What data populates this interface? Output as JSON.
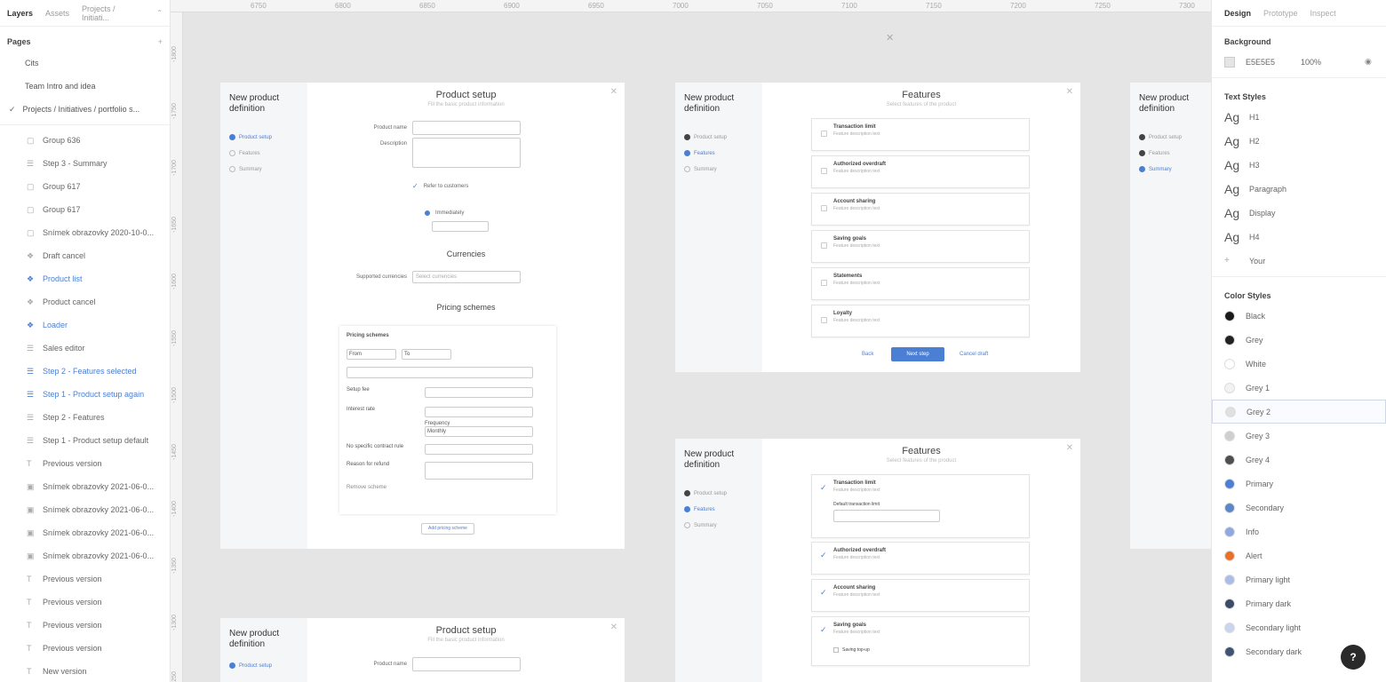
{
  "left_panel": {
    "tabs": [
      "Layers",
      "Assets",
      "Projects / Initiati..."
    ],
    "pages_title": "Pages",
    "add_icon": "plus-icon",
    "pages": [
      "Cits",
      "Team Intro and idea",
      "Projects / Initiatives / portfolio s..."
    ],
    "layers": [
      {
        "label": "Group 636",
        "icon": "frame-icon",
        "blue": false
      },
      {
        "label": "Step 3 - Summary",
        "icon": "grid-icon",
        "blue": false
      },
      {
        "label": "Group 617",
        "icon": "frame-icon",
        "blue": false
      },
      {
        "label": "Group 617",
        "icon": "frame-icon",
        "blue": false
      },
      {
        "label": "Snímek obrazovky 2020-10-0...",
        "icon": "frame-icon",
        "blue": false
      },
      {
        "label": "Draft cancel",
        "icon": "component-icon",
        "blue": false
      },
      {
        "label": "Product list",
        "icon": "component-icon",
        "blue": true
      },
      {
        "label": "Product cancel",
        "icon": "component-icon",
        "blue": false
      },
      {
        "label": "Loader",
        "icon": "component-icon",
        "blue": true
      },
      {
        "label": "Sales editor",
        "icon": "grid-icon",
        "blue": false
      },
      {
        "label": "Step 2 - Features selected",
        "icon": "grid-icon",
        "blue": true
      },
      {
        "label": "Step 1 - Product setup again",
        "icon": "grid-icon",
        "blue": true
      },
      {
        "label": "Step 2 - Features",
        "icon": "grid-icon",
        "blue": false
      },
      {
        "label": "Step 1 - Product setup default",
        "icon": "grid-icon",
        "blue": false
      },
      {
        "label": "Previous version",
        "icon": "text-icon",
        "blue": false
      },
      {
        "label": "Snímek obrazovky 2021-06-0...",
        "icon": "image-icon",
        "blue": false
      },
      {
        "label": "Snímek obrazovky 2021-06-0...",
        "icon": "image-icon",
        "blue": false
      },
      {
        "label": "Snímek obrazovky 2021-06-0...",
        "icon": "image-icon",
        "blue": false
      },
      {
        "label": "Snímek obrazovky 2021-06-0...",
        "icon": "image-icon",
        "blue": false
      },
      {
        "label": "Previous version",
        "icon": "text-icon",
        "blue": false
      },
      {
        "label": "Previous version",
        "icon": "text-icon",
        "blue": false
      },
      {
        "label": "Previous version",
        "icon": "text-icon",
        "blue": false
      },
      {
        "label": "Previous version",
        "icon": "text-icon",
        "blue": false
      },
      {
        "label": "New version",
        "icon": "text-icon",
        "blue": false
      }
    ]
  },
  "ruler": {
    "top": [
      "6750",
      "6800",
      "6850",
      "6900",
      "6950",
      "7000",
      "7050",
      "7100",
      "7150",
      "7200",
      "7250",
      "7300"
    ],
    "left": [
      "-1800",
      "-1750",
      "-1700",
      "-1650",
      "-1600",
      "-1550",
      "-1500",
      "-1450",
      "-1400",
      "-1350",
      "-1300",
      "-1250"
    ]
  },
  "frames": {
    "side_title": "New product definition",
    "steps": [
      "Product setup",
      "Features",
      "Summary"
    ],
    "product_setup": {
      "title": "Product setup",
      "subtitle": "Fill the basic product information",
      "product_name_label": "Product name",
      "description_label": "Description",
      "refer_label": "Refer to customers",
      "immediately_label": "Immediately",
      "currencies_title": "Currencies",
      "supported_currencies_label": "Supported currencies",
      "supported_currencies_value": "Select currencies",
      "pricing_title": "Pricing schemes",
      "pricing_card_title": "Pricing schemes",
      "from": "From",
      "to": "To",
      "setup_fee": "Setup fee",
      "interest_rate": "Interest rate",
      "frequency": "Frequency",
      "monthly": "Monthly",
      "no_specific_label": "No specific contract rule",
      "reason_label": "Reason for refund",
      "remove_label": "Remove scheme",
      "add_button": "Add pricing scheme"
    },
    "features": {
      "title": "Features",
      "subtitle": "Select features of the product",
      "items": [
        "Transaction limit",
        "Authorized overdraft",
        "Account sharing",
        "Saving goals",
        "Statements",
        "Loyalty"
      ],
      "item_desc": "Feature description text",
      "back": "Back",
      "next": "Next step",
      "cancel": "Cancel draft"
    },
    "features_selected": {
      "title": "Features",
      "subtitle": "Select features of the product",
      "items": [
        "Transaction limit",
        "Authorized overdraft",
        "Account sharing",
        "Saving goals"
      ],
      "limit_label": "Default transaction limit",
      "saving_option": "Saving top-up"
    }
  },
  "right_panel": {
    "tabs": [
      "Design",
      "Prototype",
      "Inspect"
    ],
    "background_title": "Background",
    "bg_hex": "E5E5E5",
    "bg_opacity": "100%",
    "eye_icon": "eye-icon",
    "text_styles_title": "Text Styles",
    "text_styles": [
      "H1",
      "H2",
      "H3",
      "Paragraph",
      "Display",
      "H4",
      "Your"
    ],
    "color_styles_title": "Color Styles",
    "color_styles": [
      {
        "name": "Black",
        "color": "#1a1a1a"
      },
      {
        "name": "Grey",
        "color": "#222222"
      },
      {
        "name": "White",
        "color": "#ffffff"
      },
      {
        "name": "Grey 1",
        "color": "#f2f2f2"
      },
      {
        "name": "Grey 2",
        "color": "#e0e0e0"
      },
      {
        "name": "Grey 3",
        "color": "#cfcfcf"
      },
      {
        "name": "Grey 4",
        "color": "#4f4f4f"
      },
      {
        "name": "Primary",
        "color": "#4a7fd4"
      },
      {
        "name": "Secondary",
        "color": "#5b86c8"
      },
      {
        "name": "Info",
        "color": "#8fa9e0"
      },
      {
        "name": "Alert",
        "color": "#e8702a"
      },
      {
        "name": "Primary light",
        "color": "#a9bde6"
      },
      {
        "name": "Primary dark",
        "color": "#3b4a66"
      },
      {
        "name": "Secondary light",
        "color": "#c9d5ef"
      },
      {
        "name": "Secondary dark",
        "color": "#3f5470"
      }
    ],
    "help_label": "?"
  }
}
